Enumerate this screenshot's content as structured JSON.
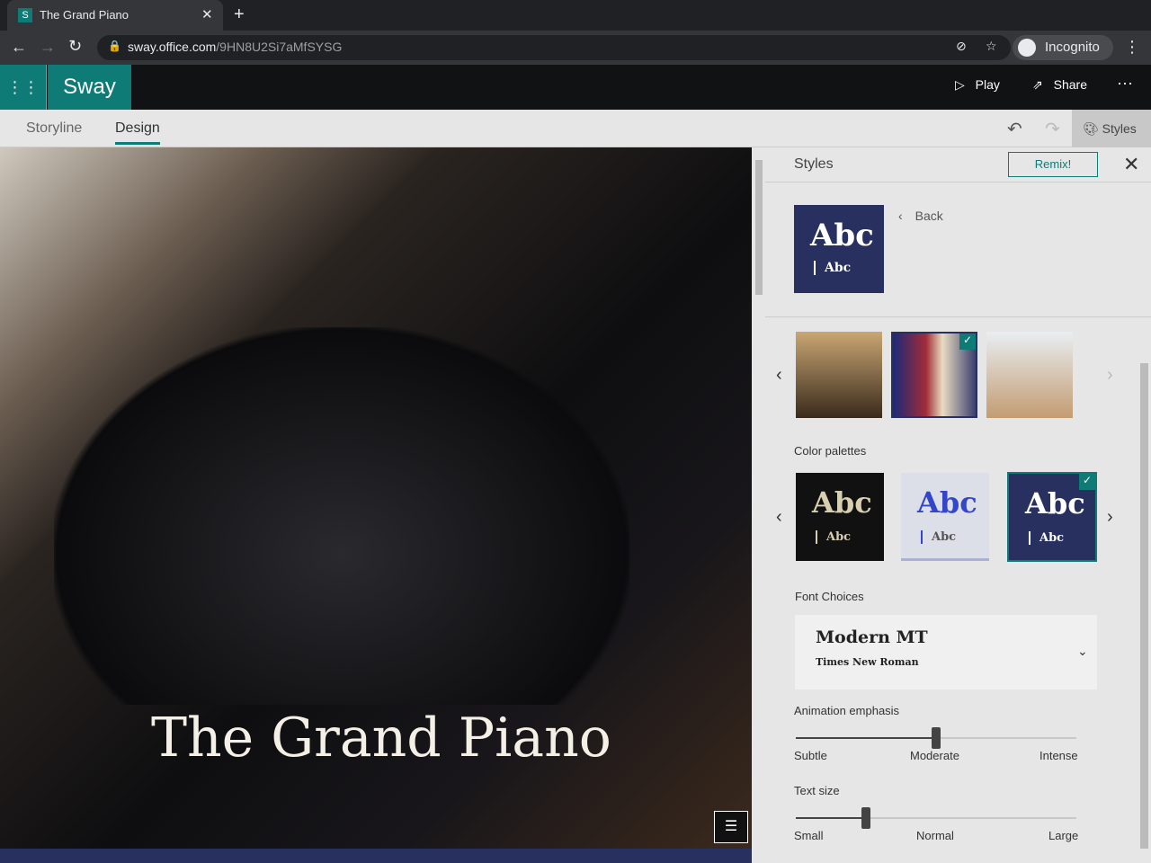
{
  "browser": {
    "tab_title": "The Grand Piano",
    "url_host": "sway.office.com",
    "url_path": "/9HN8U2Si7aMfSYSG",
    "profile": "Incognito"
  },
  "app": {
    "name": "Sway",
    "play": "Play",
    "share": "Share"
  },
  "toolbar": {
    "tabs": [
      "Storyline",
      "Design"
    ],
    "active": "Design",
    "styles": "Styles"
  },
  "stage": {
    "title": "The Grand Piano"
  },
  "panel": {
    "title": "Styles",
    "remix": "Remix!",
    "back": "Back",
    "preview": {
      "big": "Abc",
      "small": "Abc"
    },
    "color_palettes_label": "Color palettes",
    "palettes": [
      {
        "big": "Abc",
        "small": "Abc",
        "bg": "#111111",
        "fg": "#d8cfb0"
      },
      {
        "big": "Abc",
        "small": "Abc",
        "bg": "#dcdfe8",
        "fg": "#3346c8"
      },
      {
        "big": "Abc",
        "small": "Abc",
        "bg": "#27305e",
        "fg": "#ffffff"
      }
    ],
    "font_choices_label": "Font Choices",
    "font_primary": "Modern MT",
    "font_secondary": "Times New Roman",
    "animation_label": "Animation emphasis",
    "animation_stops": [
      "Subtle",
      "Moderate",
      "Intense"
    ],
    "animation_value": 0.5,
    "text_size_label": "Text size",
    "text_size_stops": [
      "Small",
      "Normal",
      "Large"
    ],
    "text_size_value": 0.25
  }
}
